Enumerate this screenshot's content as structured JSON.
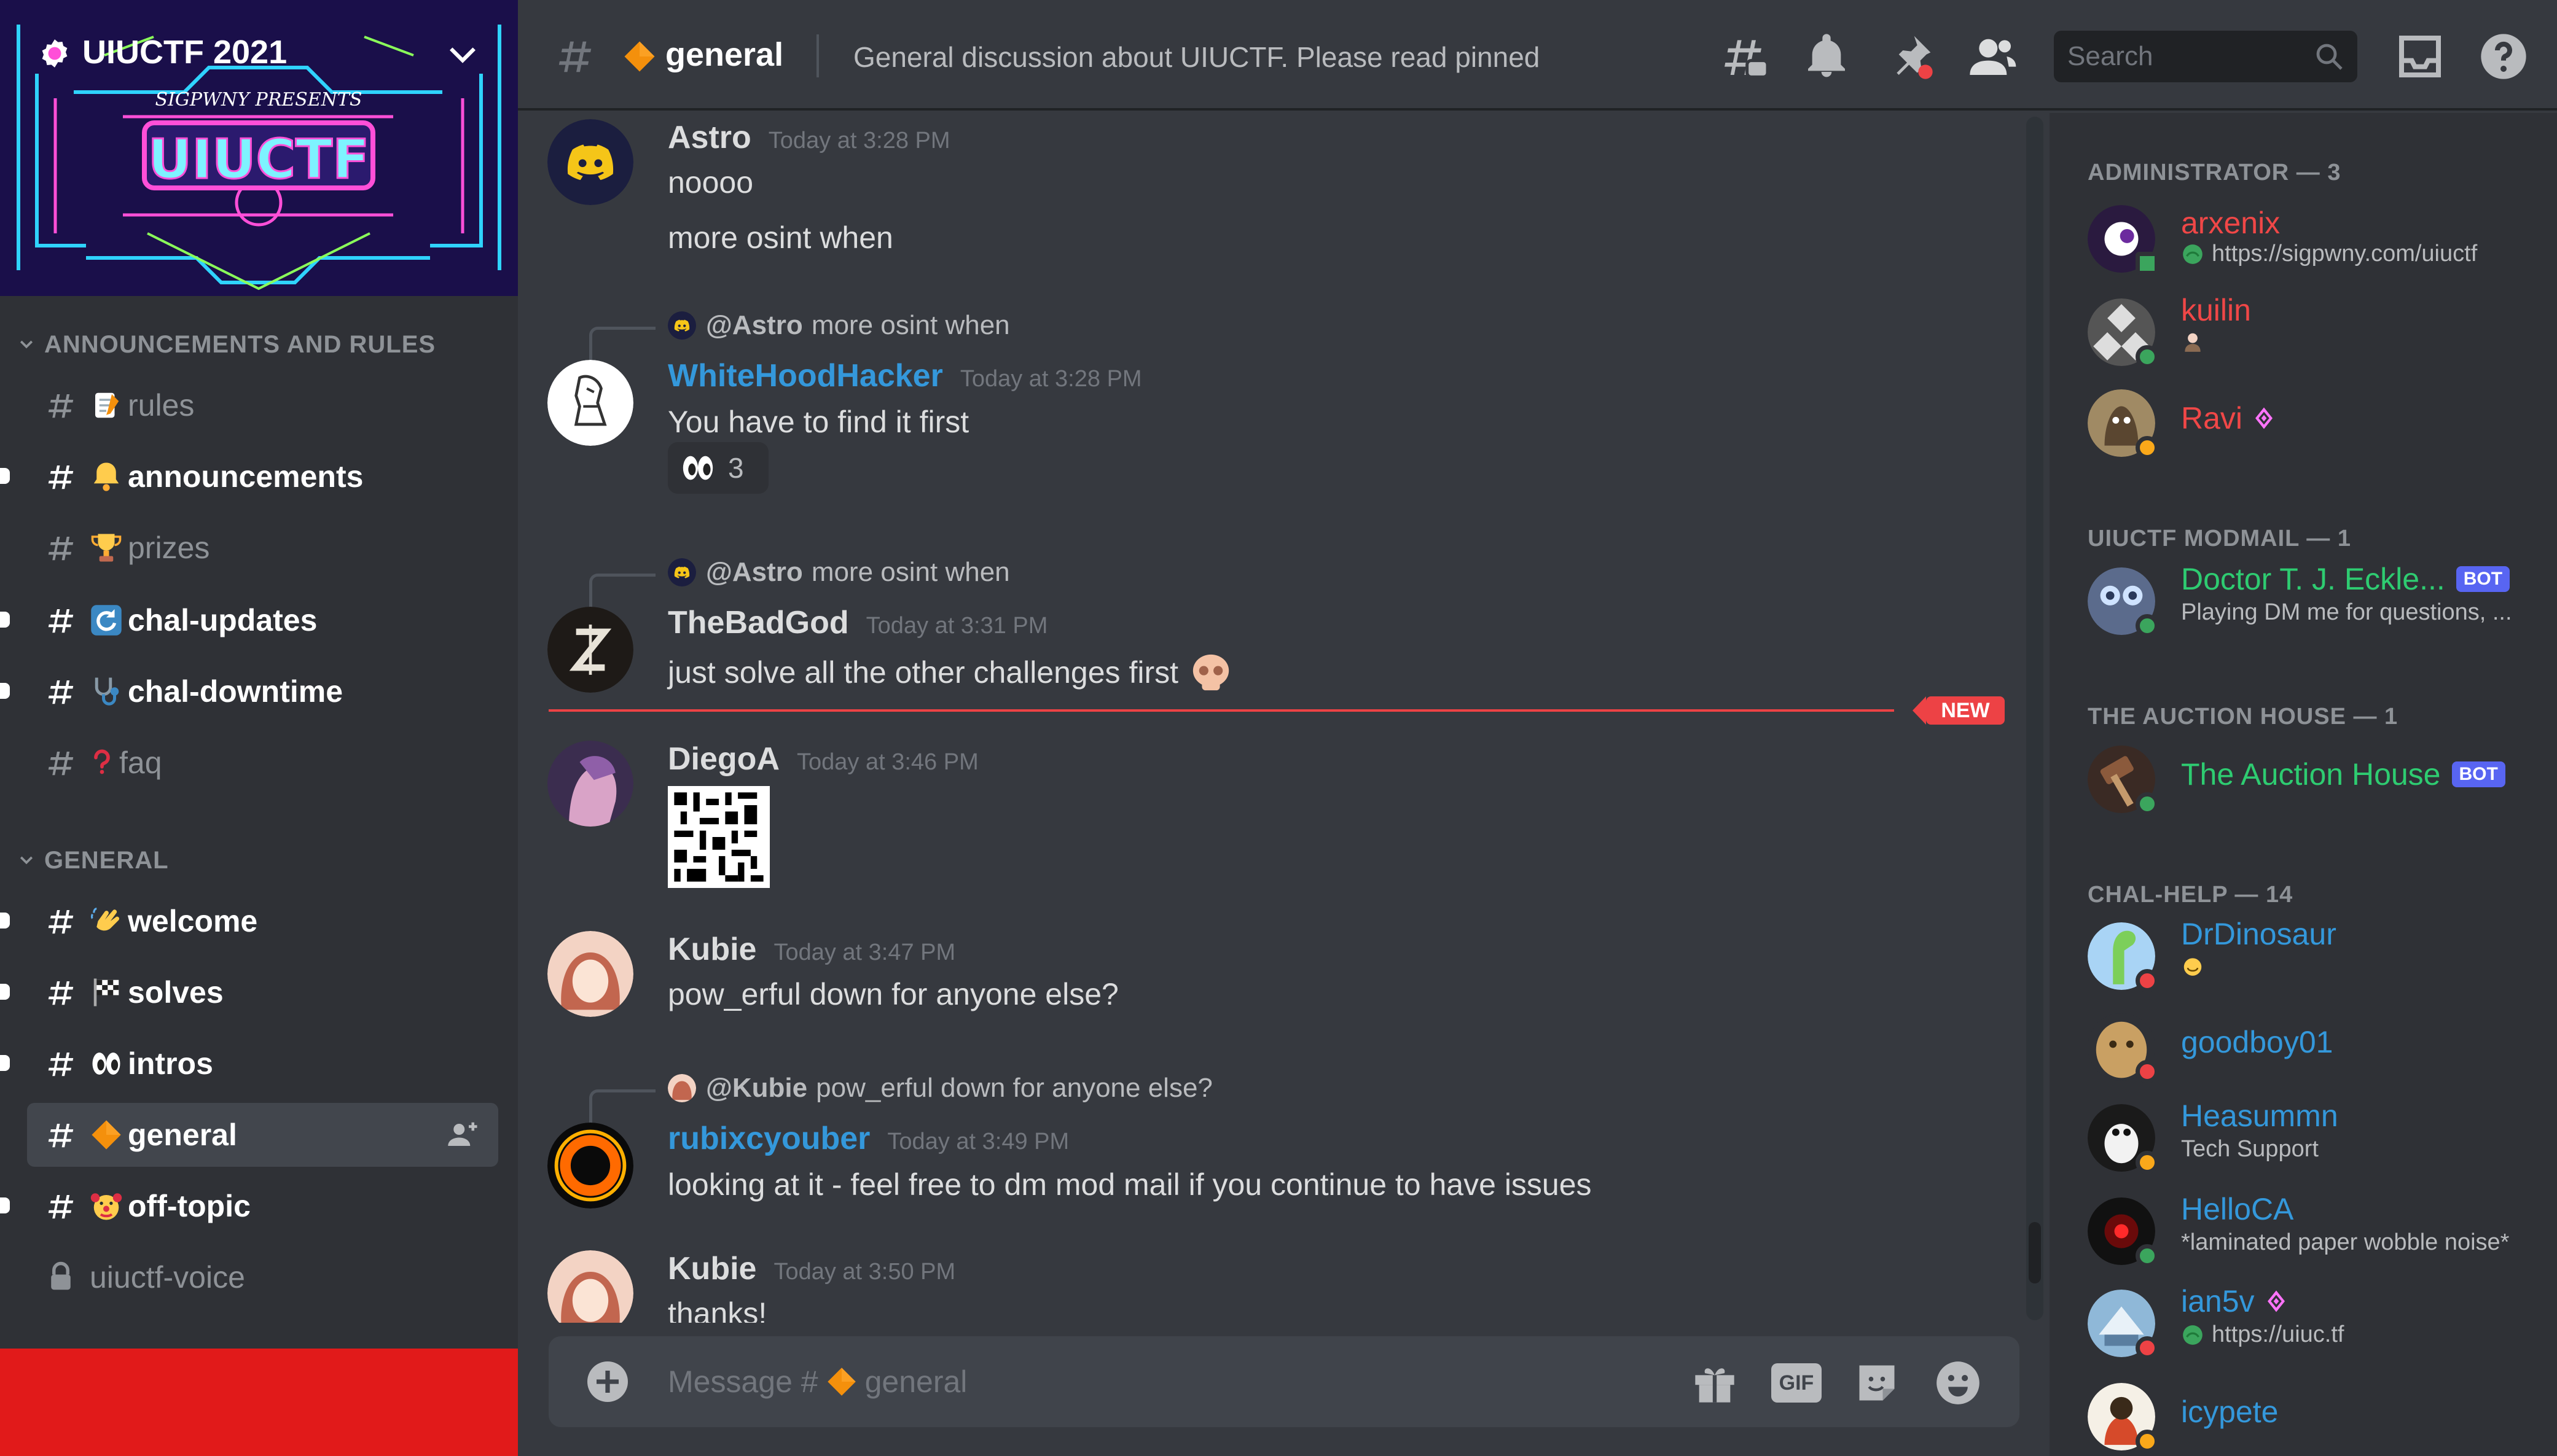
{
  "server": {
    "name": "UIUCTF 2021",
    "banner_text": "UIUCTF",
    "banner_subtext": "SIGPWNY PRESENTS"
  },
  "sidebar": {
    "categories": [
      {
        "label": "ANNOUNCEMENTS AND RULES"
      },
      {
        "label": "GENERAL"
      }
    ],
    "channels": [
      {
        "label": "rules",
        "emoji": "memo-icon",
        "state": "read"
      },
      {
        "label": "announcements",
        "emoji": "bell-icon",
        "state": "unread"
      },
      {
        "label": "prizes",
        "emoji": "trophy-icon",
        "state": "read"
      },
      {
        "label": "chal-updates",
        "emoji": "refresh-icon",
        "state": "unread"
      },
      {
        "label": "chal-downtime",
        "emoji": "stethoscope-icon",
        "state": "unread"
      },
      {
        "label": "faq",
        "emoji": "question-icon",
        "state": "read"
      },
      {
        "label": "welcome",
        "emoji": "wave-icon",
        "state": "unread"
      },
      {
        "label": "solves",
        "emoji": "checkered-flag-icon",
        "state": "unread"
      },
      {
        "label": "intros",
        "emoji": "eyes-icon",
        "state": "unread"
      },
      {
        "label": "general",
        "emoji": "orange-diamond-icon",
        "state": "active"
      },
      {
        "label": "off-topic",
        "emoji": "clown-icon",
        "state": "unread"
      },
      {
        "label": "uiuctf-voice",
        "emoji": "lock-icon",
        "state": "read"
      }
    ]
  },
  "header": {
    "channel": "general",
    "topic": "General discussion about UIUCTF. Please read pinned",
    "search_placeholder": "Search"
  },
  "messages": [
    {
      "author": "Astro",
      "time": "Today at 3:28 PM",
      "lines": [
        "noooo",
        "more osint when"
      ],
      "color": "#ffffff"
    },
    {
      "reply_to": "@Astro",
      "reply_text": "more osint when",
      "author": "WhiteHoodHacker",
      "time": "Today at 3:28 PM",
      "lines": [
        "You have to find it first"
      ],
      "color": "#3498db",
      "reaction": {
        "icon": "eyes-icon",
        "count": "3"
      }
    },
    {
      "reply_to": "@Astro",
      "reply_text": "more osint when",
      "author": "TheBadGod",
      "time": "Today at 3:31 PM",
      "lines": [
        "just solve all the other challenges first"
      ],
      "color": "#ffffff"
    },
    {
      "author": "DiegoA",
      "time": "Today at 3:46 PM",
      "lines": [],
      "color": "#ffffff",
      "attachment": "barcode-image"
    },
    {
      "author": "Kubie",
      "time": "Today at 3:47 PM",
      "lines": [
        "pow_erful down for anyone else?"
      ],
      "color": "#ffffff"
    },
    {
      "reply_to": "@Kubie",
      "reply_text": "pow_erful down for anyone else?",
      "author": "rubixcyouber",
      "time": "Today at 3:49 PM",
      "lines": [
        "looking at it - feel free to dm mod mail if you continue to have issues"
      ],
      "color": "#3498db"
    },
    {
      "author": "Kubie",
      "time": "Today at 3:50 PM",
      "lines": [
        "thanks!"
      ],
      "color": "#ffffff"
    }
  ],
  "new_badge": "NEW",
  "composer": {
    "placeholder_prefix": "Message #",
    "placeholder_channel": "general",
    "gif_label": "GIF"
  },
  "members": {
    "groups": [
      {
        "label": "ADMINISTRATOR — 3"
      },
      {
        "label": "UIUCTF MODMAIL — 1"
      },
      {
        "label": "THE AUCTION HOUSE — 1"
      },
      {
        "label": "CHAL-HELP — 14"
      }
    ],
    "list": [
      {
        "name": "arxenix",
        "status_text": "https://sigpwny.com/uiuctf",
        "presence": "online-mobile",
        "color": "#f04747"
      },
      {
        "name": "kuilin",
        "status_text": "",
        "presence": "online",
        "color": "#f04747"
      },
      {
        "name": "Ravi",
        "status_text": "",
        "presence": "idle",
        "color": "#f04747",
        "nitro": true
      },
      {
        "name": "Doctor T. J. Eckle...",
        "status_text": "Playing DM me for questions, ...",
        "presence": "online",
        "color": "#2ecc71",
        "bot": "BOT"
      },
      {
        "name": "The Auction House",
        "status_text": "",
        "presence": "online",
        "color": "#2ecc71",
        "bot": "BOT"
      },
      {
        "name": "DrDinosaur",
        "status_text": "",
        "presence": "dnd",
        "color": "#3498db"
      },
      {
        "name": "goodboy01",
        "status_text": "",
        "presence": "dnd",
        "color": "#3498db"
      },
      {
        "name": "Heasummn",
        "status_text": "Tech Support",
        "presence": "idle",
        "color": "#3498db"
      },
      {
        "name": "HelloCA",
        "status_text": "*laminated paper wobble noise*",
        "presence": "online",
        "color": "#3498db"
      },
      {
        "name": "ian5v",
        "status_text": "https://uiuc.tf",
        "presence": "dnd",
        "color": "#3498db",
        "nitro": true
      },
      {
        "name": "icypete",
        "status_text": "",
        "presence": "idle",
        "color": "#3498db"
      }
    ]
  },
  "colors": {
    "accent": "#5865f2",
    "danger": "#ed4245",
    "online": "#3ba55d",
    "idle": "#faa81a",
    "dnd": "#ed4245"
  }
}
